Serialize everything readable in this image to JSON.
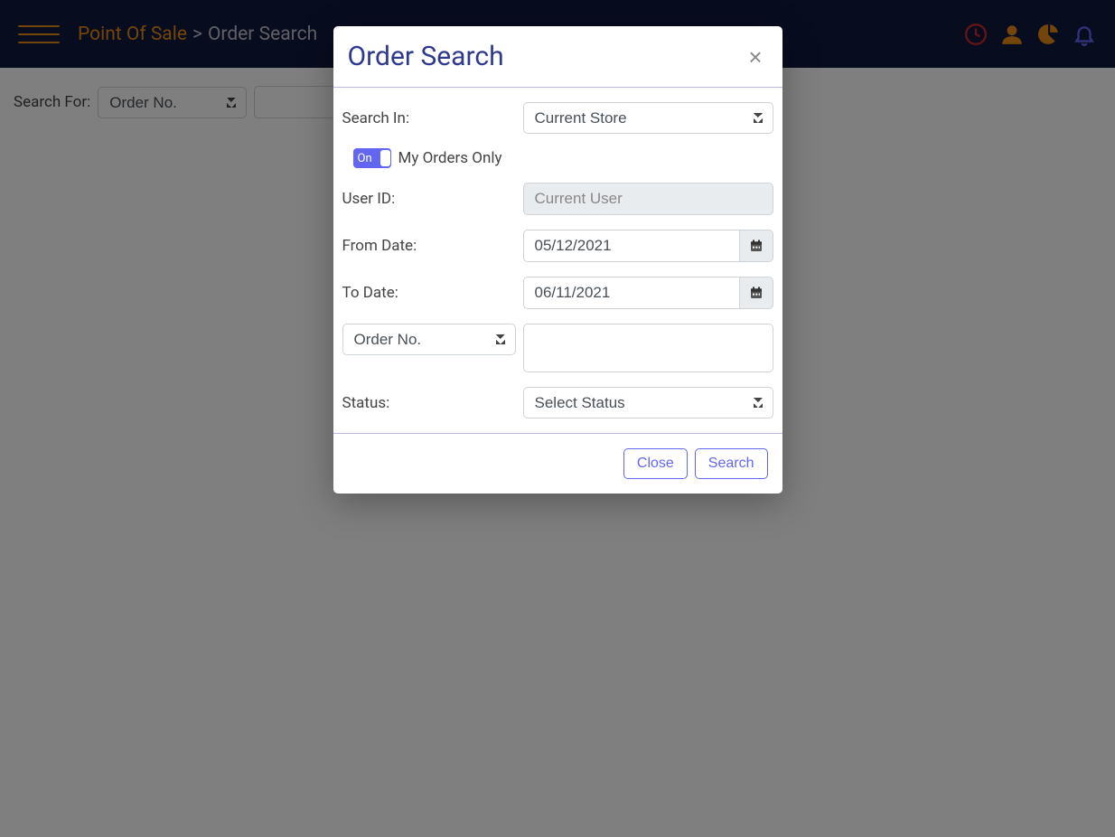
{
  "header": {
    "breadcrumb_root": "Point Of Sale",
    "breadcrumb_sep": ">",
    "breadcrumb_current": "Order Search"
  },
  "page": {
    "search_for_label": "Search For:",
    "search_for_value": "Order No."
  },
  "modal": {
    "title": "Order Search",
    "close_symbol": "×",
    "search_in_label": "Search In:",
    "search_in_value": "Current Store",
    "toggle_on": "On",
    "my_orders_only": "My Orders Only",
    "user_id_label": "User ID:",
    "user_id_value": "Current User",
    "from_date_label": "From Date:",
    "from_date_value": "05/12/2021",
    "to_date_label": "To Date:",
    "to_date_value": "06/11/2021",
    "order_field_select": "Order No.",
    "status_label": "Status:",
    "status_value": "Select Status",
    "close_btn": "Close",
    "search_btn": "Search"
  }
}
